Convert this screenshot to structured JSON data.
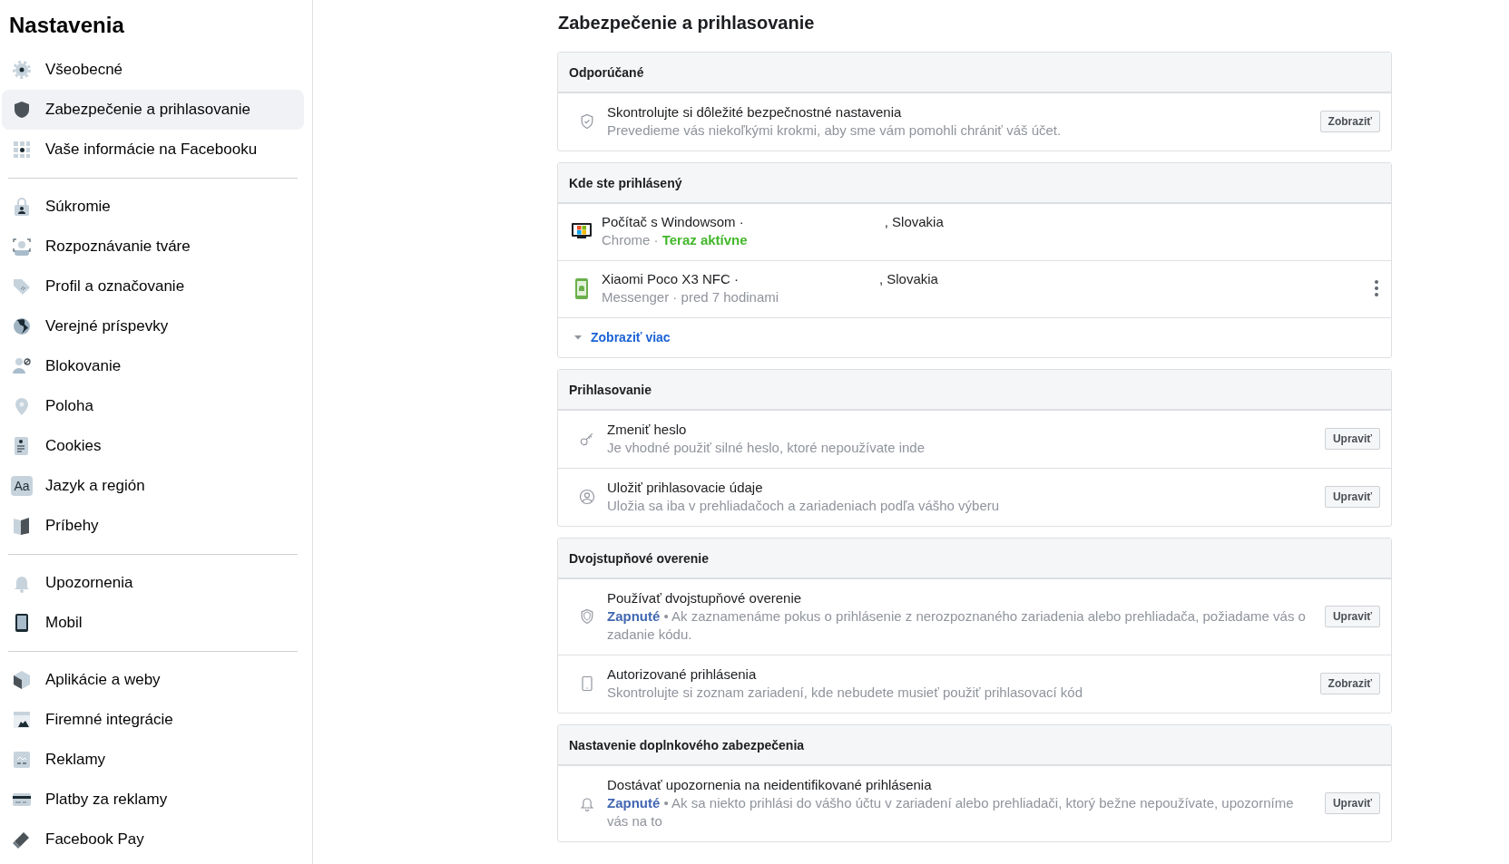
{
  "sidebar": {
    "title": "Nastavenia",
    "groups": [
      {
        "items": [
          {
            "label": "Všeobecné",
            "selected": false
          },
          {
            "label": "Zabezpečenie a prihlasovanie",
            "selected": true
          },
          {
            "label": "Vaše informácie na Facebooku",
            "selected": false
          }
        ]
      },
      {
        "items": [
          {
            "label": "Súkromie",
            "selected": false
          },
          {
            "label": "Rozpoznávanie tváre",
            "selected": false
          },
          {
            "label": "Profil a označovanie",
            "selected": false
          },
          {
            "label": "Verejné príspevky",
            "selected": false
          },
          {
            "label": "Blokovanie",
            "selected": false
          },
          {
            "label": "Poloha",
            "selected": false
          },
          {
            "label": "Cookies",
            "selected": false
          },
          {
            "glyph": "Aa",
            "label": "Jazyk a región",
            "selected": false
          },
          {
            "label": "Príbehy",
            "selected": false
          }
        ]
      },
      {
        "items": [
          {
            "label": "Upozornenia",
            "selected": false
          },
          {
            "label": "Mobil",
            "selected": false
          }
        ]
      },
      {
        "items": [
          {
            "label": "Aplikácie a weby",
            "selected": false
          },
          {
            "label": "Firemné integrácie",
            "selected": false
          },
          {
            "label": "Reklamy",
            "selected": false
          },
          {
            "label": "Platby za reklamy",
            "selected": false
          },
          {
            "label": "Facebook Pay",
            "selected": false
          }
        ]
      }
    ]
  },
  "main": {
    "title": "Zabezpečenie a prihlasovanie",
    "sections": [
      {
        "title": "Odporúčané",
        "rows": [
          {
            "kind": "setting",
            "title": "Skontrolujte si dôležité bezpečnostné nastavenia",
            "description": "Prevedieme vás niekoľkými krokmi, aby sme vám pomohli chrániť váš účet.",
            "button": "Zobraziť"
          }
        ]
      },
      {
        "title": "Kde ste prihlásený",
        "rows": [
          {
            "kind": "session",
            "device": "Počítač s Windowsom ·",
            "location": ", Slovakia",
            "app": "Chrome ·",
            "activity": "Teraz aktívne",
            "active": true,
            "menu": false
          },
          {
            "kind": "session",
            "device": "Xiaomi Poco X3 NFC ·",
            "location": ", Slovakia",
            "app": "Messenger ·",
            "activity": "pred 7 hodinami",
            "active": false,
            "menu": true
          },
          {
            "kind": "more",
            "label": "Zobraziť viac"
          }
        ]
      },
      {
        "title": "Prihlasovanie",
        "rows": [
          {
            "kind": "setting",
            "title": "Zmeniť heslo",
            "description": "Je vhodné použiť silné heslo, ktoré nepoužívate inde",
            "button": "Upraviť"
          },
          {
            "kind": "setting",
            "title": "Uložiť prihlasovacie údaje",
            "description": "Uložia sa iba v prehliadačoch a zariadeniach podľa vášho výberu",
            "button": "Upraviť"
          }
        ]
      },
      {
        "title": "Dvojstupňové overenie",
        "rows": [
          {
            "kind": "setting",
            "title": "Používať dvojstupňové overenie",
            "status": "Zapnuté",
            "description": "• Ak zaznamenáme pokus o prihlásenie z nerozpoznaného zariadenia alebo prehliadača, požiadame vás o zadanie kódu.",
            "button": "Upraviť"
          },
          {
            "kind": "setting",
            "title": "Autorizované prihlásenia",
            "description": "Skontrolujte si zoznam zariadení, kde nebudete musieť použiť prihlasovací kód",
            "button": "Zobraziť"
          }
        ]
      },
      {
        "title": "Nastavenie doplnkového zabezpečenia",
        "rows": [
          {
            "kind": "setting",
            "title": "Dostávať upozornenia na neidentifikované prihlásenia",
            "status": "Zapnuté",
            "description": "• Ak sa niekto prihlási do vášho účtu v zariadení alebo prehliadači, ktorý bežne nepoužívate, upozorníme vás na to",
            "button": "Upraviť"
          }
        ]
      }
    ]
  }
}
